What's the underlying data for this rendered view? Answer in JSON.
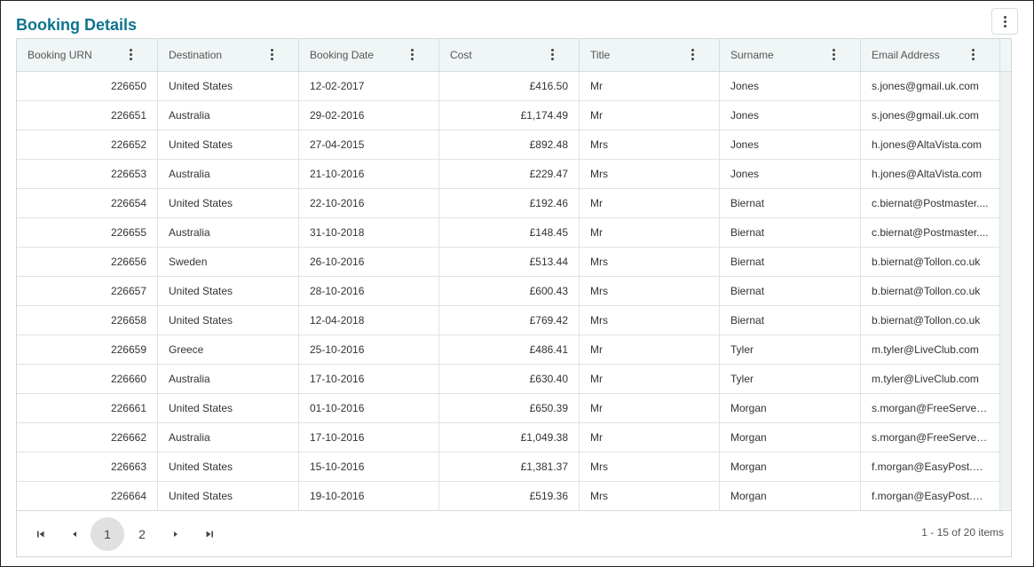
{
  "title": "Booking Details",
  "columns": [
    "Booking URN",
    "Destination",
    "Booking Date",
    "Cost",
    "Title",
    "Surname",
    "Email Address"
  ],
  "rows": [
    [
      "226650",
      "United States",
      "12-02-2017",
      "£416.50",
      "Mr",
      "Jones",
      "s.jones@gmail.uk.com"
    ],
    [
      "226651",
      "Australia",
      "29-02-2016",
      "£1,174.49",
      "Mr",
      "Jones",
      "s.jones@gmail.uk.com"
    ],
    [
      "226652",
      "United States",
      "27-04-2015",
      "£892.48",
      "Mrs",
      "Jones",
      "h.jones@AltaVista.com"
    ],
    [
      "226653",
      "Australia",
      "21-10-2016",
      "£229.47",
      "Mrs",
      "Jones",
      "h.jones@AltaVista.com"
    ],
    [
      "226654",
      "United States",
      "22-10-2016",
      "£192.46",
      "Mr",
      "Biernat",
      "c.biernat@Postmaster...."
    ],
    [
      "226655",
      "Australia",
      "31-10-2018",
      "£148.45",
      "Mr",
      "Biernat",
      "c.biernat@Postmaster...."
    ],
    [
      "226656",
      "Sweden",
      "26-10-2016",
      "£513.44",
      "Mrs",
      "Biernat",
      "b.biernat@Tollon.co.uk"
    ],
    [
      "226657",
      "United States",
      "28-10-2016",
      "£600.43",
      "Mrs",
      "Biernat",
      "b.biernat@Tollon.co.uk"
    ],
    [
      "226658",
      "United States",
      "12-04-2018",
      "£769.42",
      "Mrs",
      "Biernat",
      "b.biernat@Tollon.co.uk"
    ],
    [
      "226659",
      "Greece",
      "25-10-2016",
      "£486.41",
      "Mr",
      "Tyler",
      "m.tyler@LiveClub.com"
    ],
    [
      "226660",
      "Australia",
      "17-10-2016",
      "£630.40",
      "Mr",
      "Tyler",
      "m.tyler@LiveClub.com"
    ],
    [
      "226661",
      "United States",
      "01-10-2016",
      "£650.39",
      "Mr",
      "Morgan",
      "s.morgan@FreeServe.c..."
    ],
    [
      "226662",
      "Australia",
      "17-10-2016",
      "£1,049.38",
      "Mr",
      "Morgan",
      "s.morgan@FreeServe.c..."
    ],
    [
      "226663",
      "United States",
      "15-10-2016",
      "£1,381.37",
      "Mrs",
      "Morgan",
      "f.morgan@EasyPost.uk..."
    ],
    [
      "226664",
      "United States",
      "19-10-2016",
      "£519.36",
      "Mrs",
      "Morgan",
      "f.morgan@EasyPost.uk..."
    ]
  ],
  "pager": {
    "pages": [
      "1",
      "2"
    ],
    "current_page": "1",
    "summary": "1 - 15 of 20 items"
  },
  "colors": {
    "title": "#0e7490",
    "header_bg": "#f0f6f6",
    "active_page_bg": "#e0e0e0"
  },
  "icons": {
    "more_menu": "more-vertical-icon",
    "first": "first-page-icon",
    "prev": "previous-page-icon",
    "next": "next-page-icon",
    "last": "last-page-icon"
  }
}
